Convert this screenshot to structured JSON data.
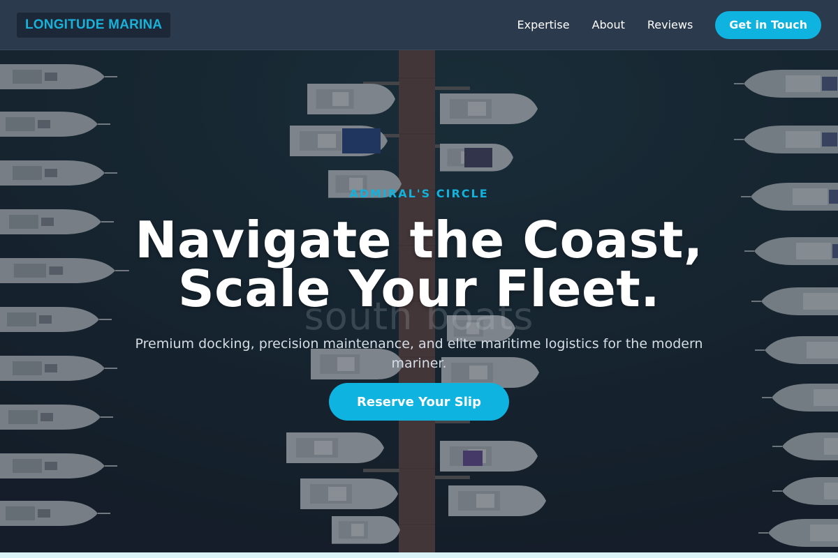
{
  "brand": {
    "name": "LONGITUDE MARINA"
  },
  "nav": {
    "links": [
      "Expertise",
      "About",
      "Reviews"
    ],
    "cta_label": "Get in Touch"
  },
  "hero": {
    "eyebrow": "ADMIRAL'S CIRCLE",
    "title": "Navigate the Coast,\nScale Your Fleet.",
    "subtitle": "Premium docking, precision maintenance, and elite maritime logistics for the modern mariner.",
    "cta_label": "Reserve Your Slip",
    "background_image": "aerial-marina-boats",
    "watermark_text": "south boats"
  },
  "colors": {
    "accent": "#0fb3df",
    "header_bg": "#2c3a4d",
    "water": "#17222e",
    "bottom_strip": "#d9f3f8"
  }
}
